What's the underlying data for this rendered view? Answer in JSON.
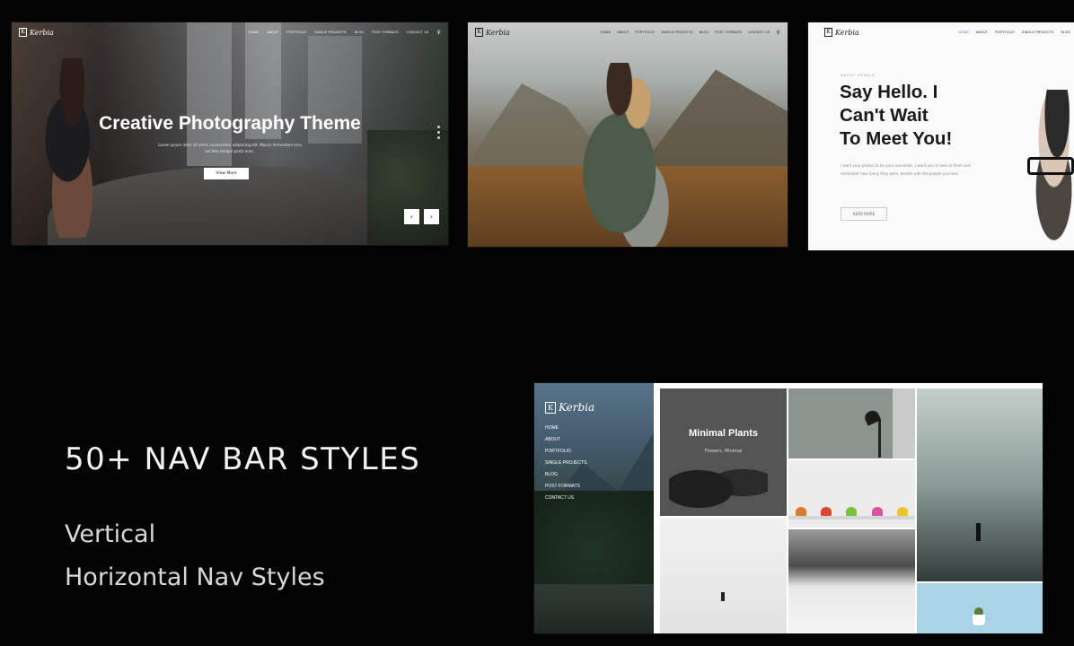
{
  "brand": {
    "logo_text": "Kerbia",
    "logo_mark": "K"
  },
  "shot1": {
    "menu": [
      "HOME",
      "ABOUT",
      "PORTFOLIO",
      "SINGLE PROJECTS",
      "BLOG",
      "POST FORMATS",
      "CONTACT US"
    ],
    "hero_title": "Creative Photography Theme",
    "hero_subtitle_line1": "Lorem ipsum dolor sit amet, consectetur adipiscing elit. Mauris fermentum eros",
    "hero_subtitle_line2": "vel felis tempor porta nunc.",
    "hero_button": "View More",
    "prev_arrow": "‹",
    "next_arrow": "›"
  },
  "shot2": {
    "menu": [
      "HOME",
      "ABOUT",
      "PORTFOLIO",
      "SINGLE PROJECTS",
      "BLOG",
      "POST FORMATS",
      "CONTACT US"
    ]
  },
  "shot3": {
    "menu": [
      "HOME",
      "ABOUT",
      "PORTFOLIO",
      "SINGLE PROJECTS",
      "BLOG"
    ],
    "eyebrow": "ABOUT KERBIA",
    "headline_line1": "Say Hello. I",
    "headline_line2": "Can't Wait",
    "headline_line3": "To Meet You!",
    "body": "I want your photos to be your essentials. I want you to look at them and remember how funny they were, beside with the people you love.",
    "button": "READ MORE"
  },
  "headline": "50+ NAV BAR STYLES",
  "features": [
    "Vertical",
    "Horizontal Nav Styles"
  ],
  "shot4": {
    "menu": [
      "HOME",
      "ABOUT",
      "PORTFOLIO",
      "SINGLE PROJECTS",
      "BLOG",
      "POST FORMATS",
      "CONTACT US"
    ],
    "tile_title": "Minimal Plants",
    "tile_subtitle": "Flowers, Minimal",
    "pot_colors": [
      "#e07a2b",
      "#d44a2f",
      "#7ac142",
      "#e04fa0",
      "#f1c232"
    ]
  }
}
